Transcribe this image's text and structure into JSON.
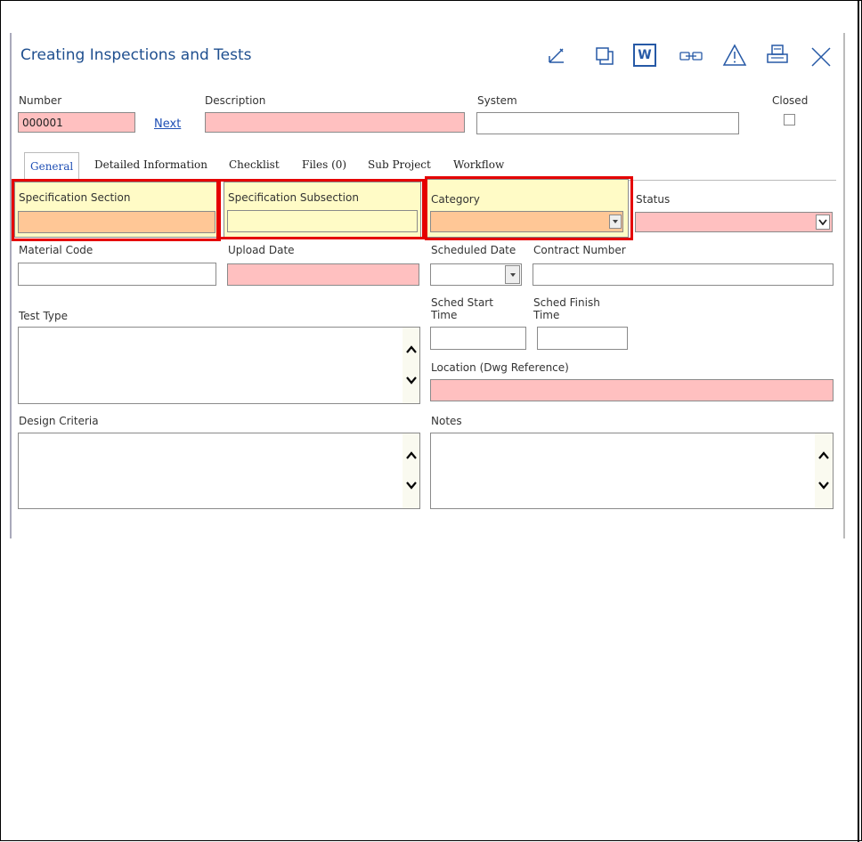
{
  "window": {
    "title": "Creating Inspections and Tests"
  },
  "toolbar": {
    "icons": [
      "edit-icon",
      "copy-icon",
      "word-icon",
      "link-icon",
      "warning-icon",
      "print-icon",
      "close-icon"
    ],
    "word_label": "W",
    "accent": "#2659a6"
  },
  "header": {
    "number_label": "Number",
    "number_value": "000001",
    "next_link": "Next",
    "description_label": "Description",
    "description_value": "",
    "system_label": "System",
    "system_value": "",
    "closed_label": "Closed"
  },
  "tabs": [
    {
      "label": "General",
      "active": true
    },
    {
      "label": "Detailed Information"
    },
    {
      "label": "Checklist"
    },
    {
      "label": "Files (0)"
    },
    {
      "label": "Sub Project"
    },
    {
      "label": "Workflow"
    }
  ],
  "form": {
    "spec_section_label": "Specification Section",
    "spec_subsection_label": "Specification Subsection",
    "category_label": "Category",
    "status_label": "Status",
    "material_code_label": "Material Code",
    "upload_date_label": "Upload Date",
    "scheduled_date_label": "Scheduled Date",
    "contract_number_label": "Contract Number",
    "test_type_label": "Test Type",
    "sched_start_label_1": "Sched Start",
    "sched_start_label_2": "Time",
    "sched_finish_label_1": "Sched Finish",
    "sched_finish_label_2": "Time",
    "location_label": "Location (Dwg Reference)",
    "design_criteria_label": "Design Criteria",
    "notes_label": "Notes"
  },
  "colors": {
    "required": "#ffc0c0",
    "highlight_box": "#fffbc6",
    "dropdown_fill": "#ffc796",
    "annotation_border": "#e50000"
  }
}
